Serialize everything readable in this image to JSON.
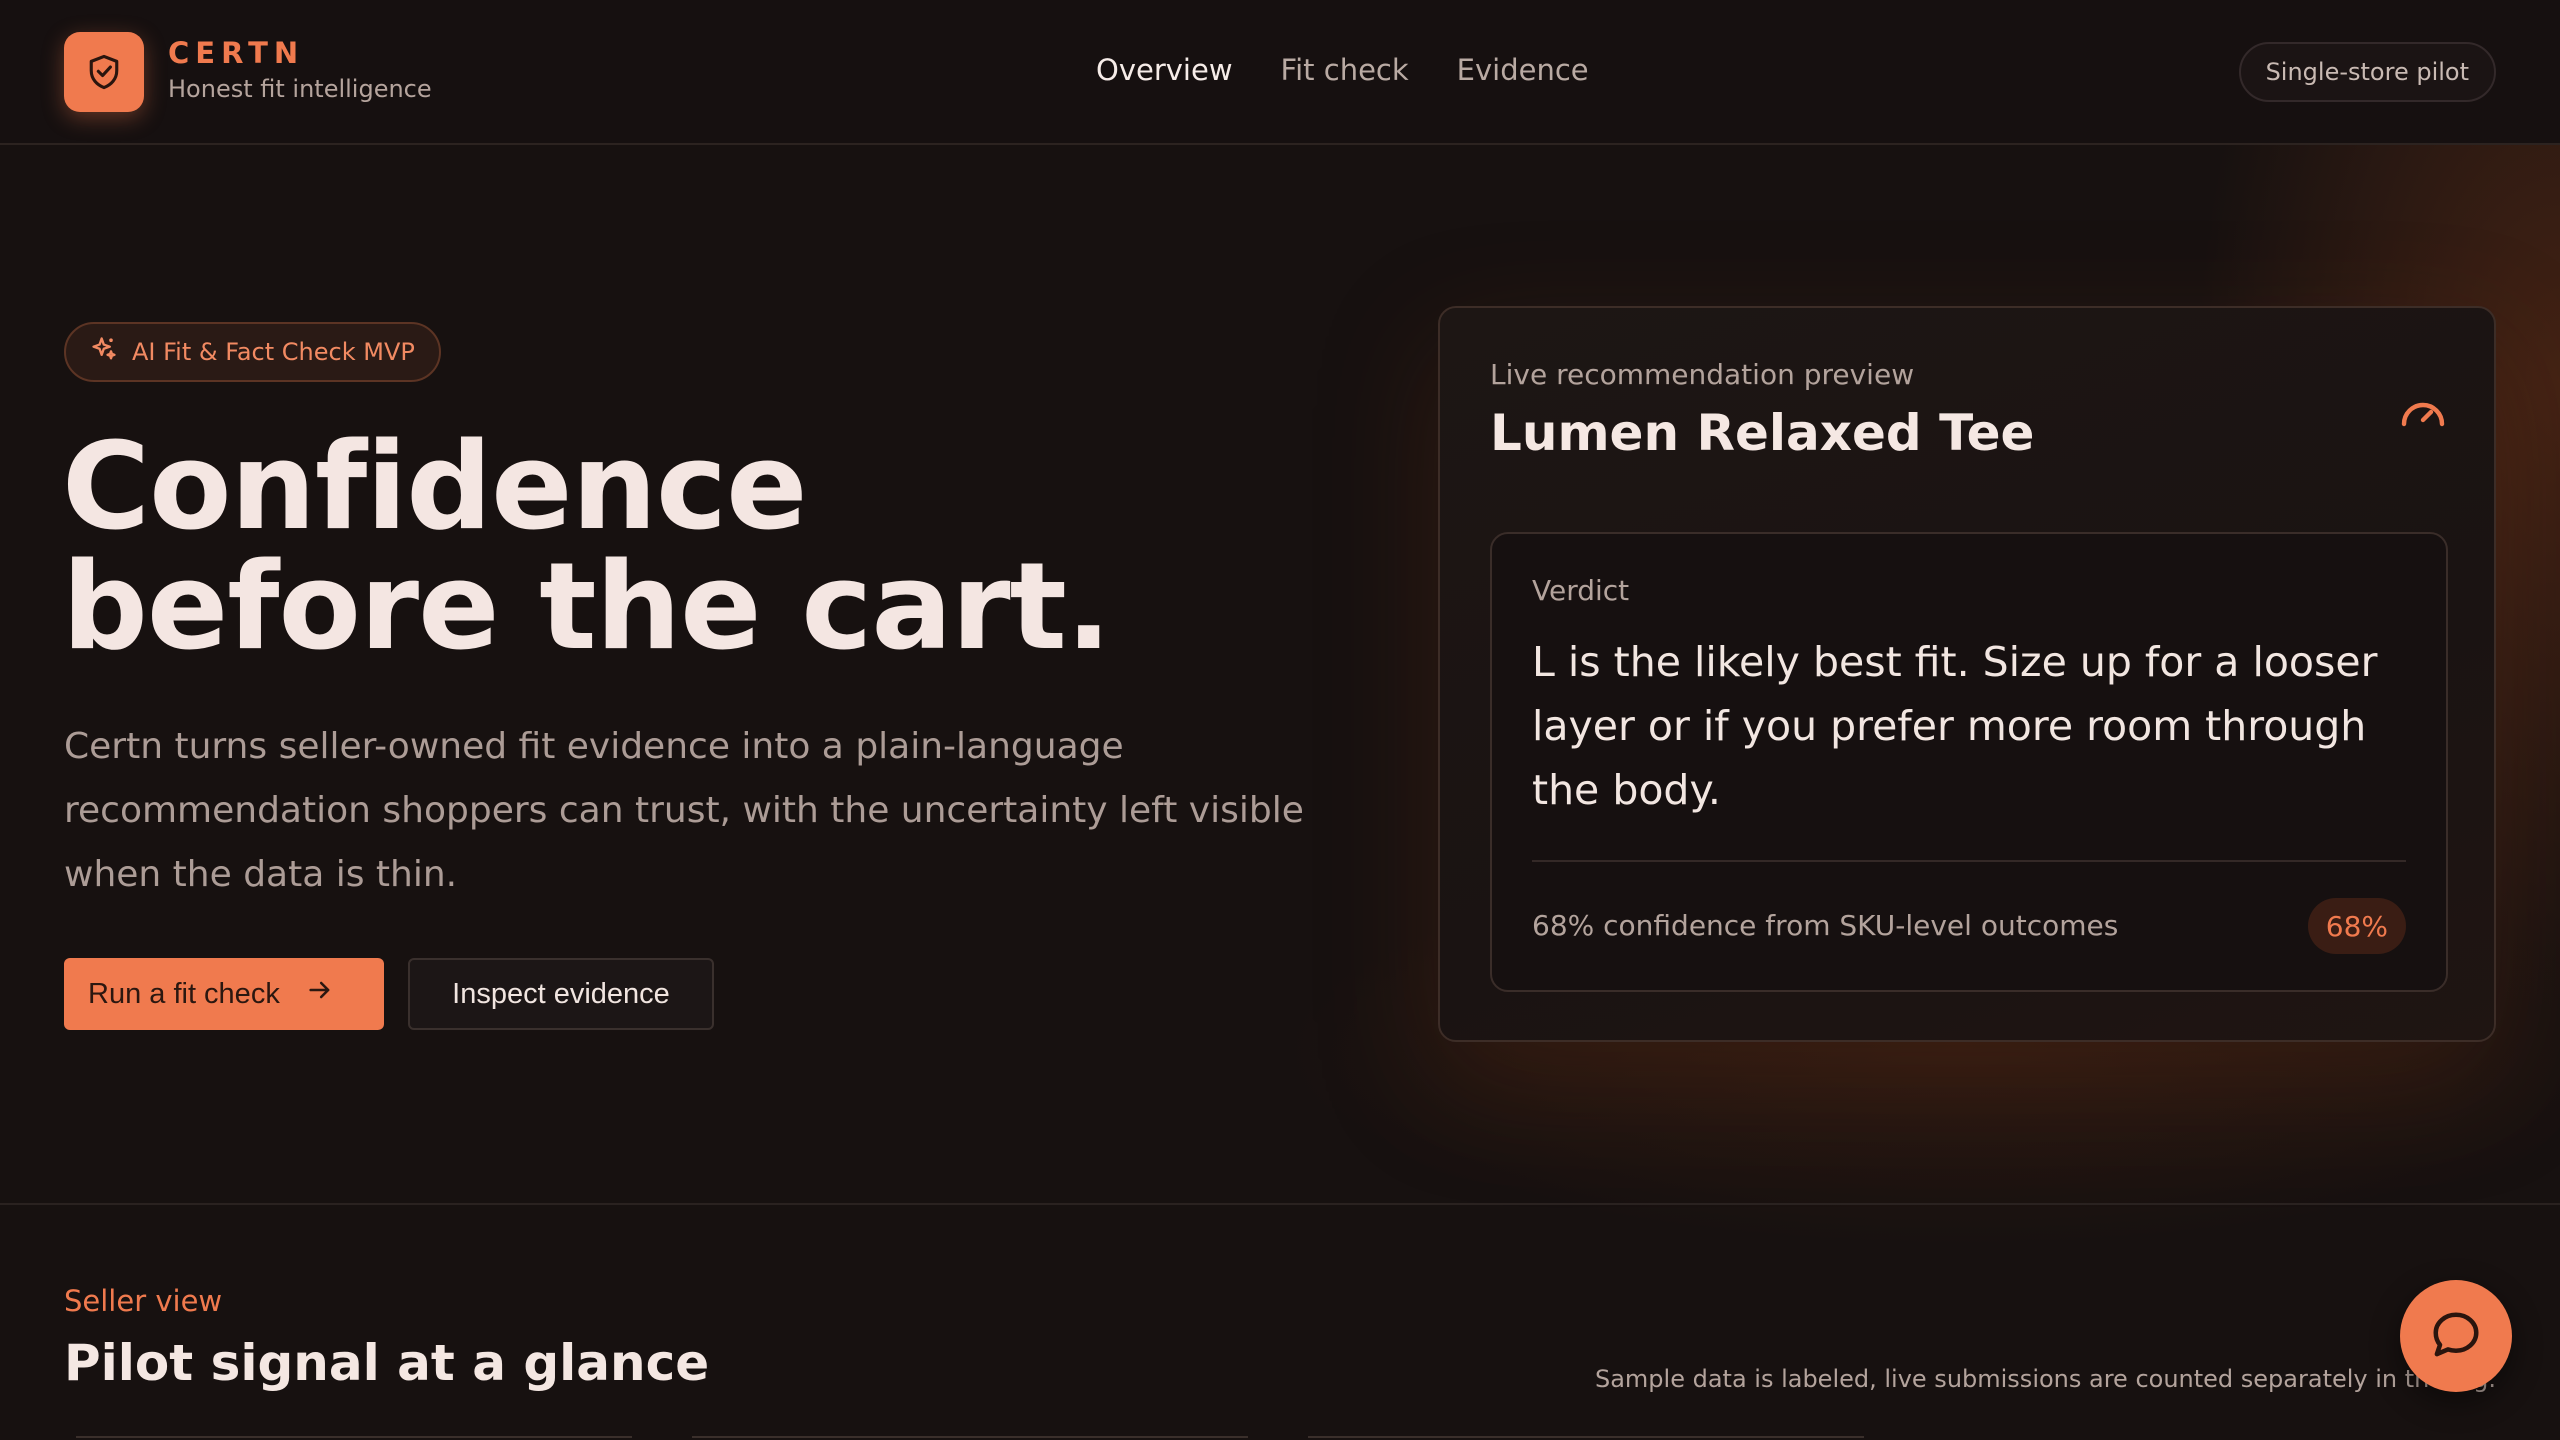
{
  "header": {
    "brand_name": "CERTN",
    "brand_tagline": "Honest fit intelligence",
    "nav": [
      {
        "label": "Overview",
        "active": true
      },
      {
        "label": "Fit check",
        "active": false
      },
      {
        "label": "Evidence",
        "active": false
      }
    ],
    "pilot_label": "Single-store pilot"
  },
  "hero": {
    "badge": "AI Fit & Fact Check MVP",
    "headline_line1": "Confidence",
    "headline_line2": "before the cart.",
    "lede": "Certn turns seller-owned fit evidence into a plain-language recommendation shoppers can trust, with the uncertainty left visible when the data is thin.",
    "primary_cta": "Run a fit check",
    "secondary_cta": "Inspect evidence"
  },
  "preview": {
    "label": "Live recommendation preview",
    "product": "Lumen Relaxed Tee",
    "verdict_label": "Verdict",
    "verdict": "L is the likely best fit. Size up for a looser layer or if you prefer more room through the body.",
    "confidence_text": "68% confidence from SKU-level outcomes",
    "confidence_pill": "68%",
    "confidence_value": 0.68
  },
  "seller": {
    "eyebrow": "Seller view",
    "title": "Pilot signal at a glance",
    "note": "Sample data is labeled, live submissions are counted separately in the log."
  },
  "icons": {
    "logo": "shield-check-icon",
    "badge": "sparkles-icon",
    "cta": "arrow-right-icon",
    "preview": "gauge-icon",
    "fab": "chat-bubble-icon"
  },
  "colors": {
    "accent": "#f07a4e",
    "background": "#171110",
    "text": "#f4e6e2",
    "muted": "#b3a39c"
  }
}
